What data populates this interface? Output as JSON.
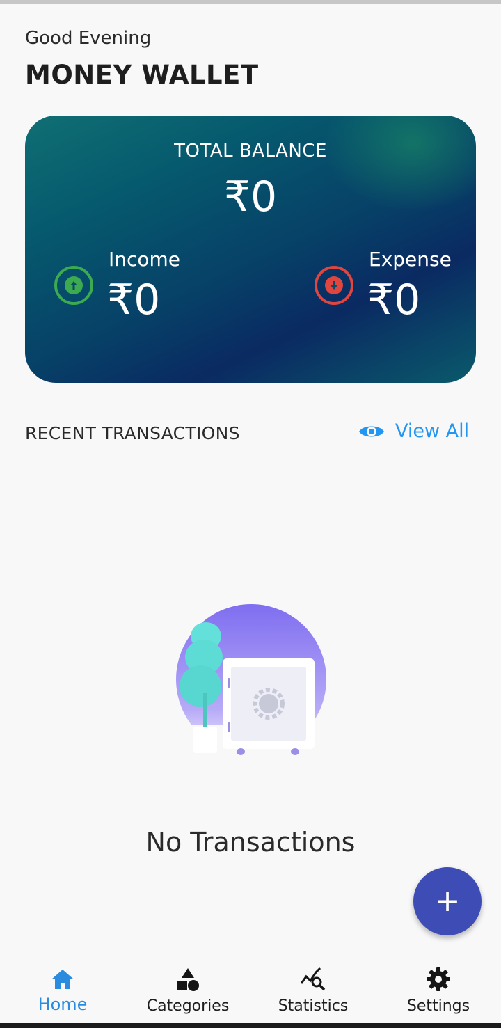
{
  "header": {
    "greeting": "Good Evening",
    "title": "MONEY WALLET"
  },
  "balance_card": {
    "total_label": "TOTAL BALANCE",
    "total_amount": "₹0",
    "income": {
      "label": "Income",
      "amount": "₹0",
      "icon": "arrow-up-circle-icon",
      "color": "#3cab4f"
    },
    "expense": {
      "label": "Expense",
      "amount": "₹0",
      "icon": "arrow-down-circle-icon",
      "color": "#e04540"
    }
  },
  "recent": {
    "title": "RECENT TRANSACTIONS",
    "view_all_label": "View All",
    "view_all_icon": "eye-icon",
    "accent": "#2196f3"
  },
  "empty_state": {
    "illustration": "safe-illustration",
    "text": "No Transactions"
  },
  "fab": {
    "icon": "plus-icon",
    "label": "+",
    "color": "#3e4db5"
  },
  "bottom_nav": {
    "items": [
      {
        "label": "Home",
        "icon": "home-icon",
        "active": true
      },
      {
        "label": "Categories",
        "icon": "shapes-icon",
        "active": false
      },
      {
        "label": "Statistics",
        "icon": "analytics-icon",
        "active": false
      },
      {
        "label": "Settings",
        "icon": "gear-icon",
        "active": false
      }
    ],
    "active_color": "#2a8bdf"
  }
}
